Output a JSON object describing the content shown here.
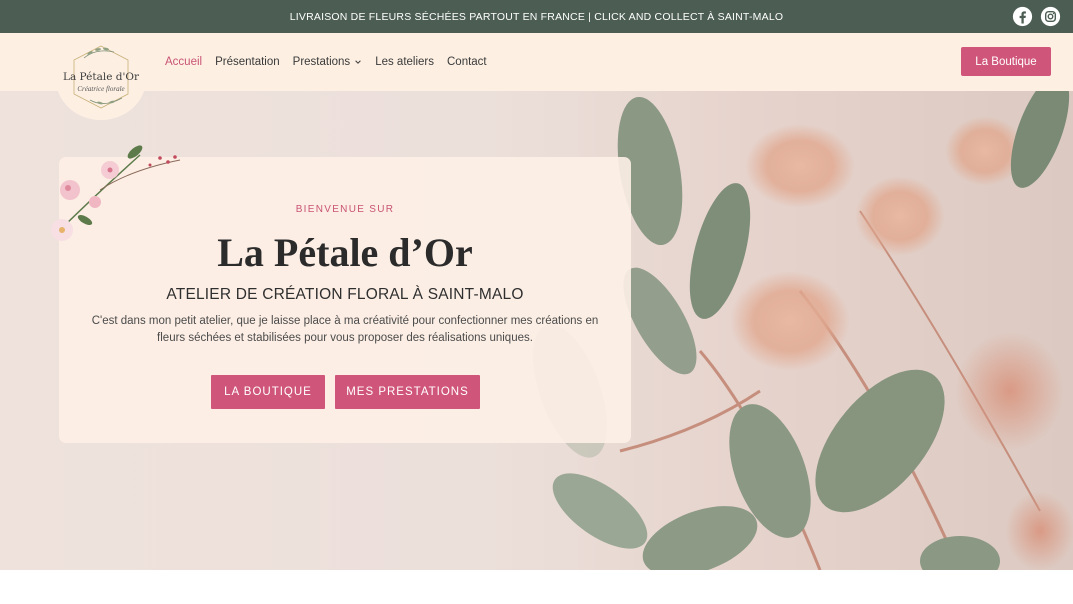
{
  "topbar": {
    "announcement": "LIVRAISON DE FLEURS SÉCHÉES PARTOUT EN FRANCE | CLICK AND COLLECT À SAINT-MALO",
    "social": [
      "facebook-icon",
      "instagram-icon"
    ]
  },
  "logo": {
    "title": "La Pétale d'Or",
    "subtitle": "Créatrice florale"
  },
  "nav": {
    "items": [
      {
        "label": "Accueil"
      },
      {
        "label": "Présentation"
      },
      {
        "label": "Prestations"
      },
      {
        "label": "Les ateliers"
      },
      {
        "label": "Contact"
      }
    ],
    "cta": "La Boutique"
  },
  "hero": {
    "kicker": "BIENVENUE SUR",
    "title": "La Pétale d’Or",
    "subtitle": "ATELIER DE CRÉATION FLORAL À SAINT-MALO",
    "description": "C'est dans mon petit atelier, que je laisse place à ma créativité pour confectionner mes créations en fleurs séchées et stabilisées pour vous proposer des réalisations uniques.",
    "buttons": [
      "LA BOUTIQUE",
      "MES PRESTATIONS"
    ]
  },
  "colors": {
    "topbar": "#4c5e53",
    "header": "#fdf0e3",
    "accent": "#d0557a",
    "active_nav": "#c95474"
  }
}
